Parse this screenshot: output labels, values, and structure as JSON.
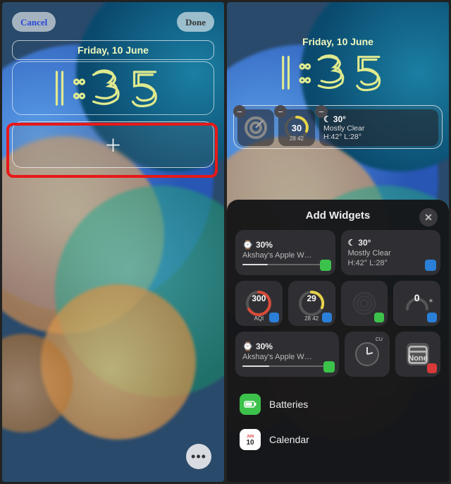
{
  "left": {
    "cancel": "Cancel",
    "done": "Done",
    "date": "Friday, 10 June",
    "time": "1:35"
  },
  "right": {
    "date": "Friday, 10 June",
    "time": "1:35",
    "widgets": {
      "gauge_value": "30",
      "gauge_sub_l": "28",
      "gauge_sub_r": "42",
      "temp": "30°",
      "cond": "Mostly Clear",
      "hl": "H:42° L:28°"
    },
    "sheet": {
      "title": "Add Widgets",
      "tiles": {
        "watch_pct": "30%",
        "watch_name": "Akshay's Apple W…",
        "temp": "30°",
        "cond": "Mostly Clear",
        "hl": "H:42° L:28°"
      },
      "sq": {
        "aqi_val": "300",
        "aqi_lbl": "AQI",
        "uv_val": "29",
        "uv_sub_l": "28",
        "uv_sub_r": "42",
        "zero": "0",
        "none": "None"
      },
      "cats": {
        "bat": "Batteries",
        "cal": "Calendar"
      }
    }
  }
}
